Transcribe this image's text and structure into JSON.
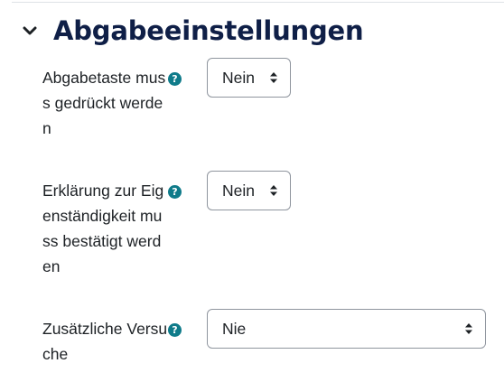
{
  "section": {
    "title": "Abgabeeinstellungen",
    "expanded_icon": "chevron-down-icon"
  },
  "fields": [
    {
      "label": "Abgabetaste muss gedrückt werden",
      "help_icon": "question-circle-icon",
      "help_glyph": "?",
      "value": "Nein"
    },
    {
      "label": "Erklärung zur Eigenständigkeit muss bestätigt werden",
      "help_icon": "question-circle-icon",
      "help_glyph": "?",
      "value": "Nein"
    },
    {
      "label": "Zusätzliche Versuche",
      "help_icon": "question-circle-icon",
      "help_glyph": "?",
      "value": "Nie"
    }
  ],
  "colors": {
    "heading": "#0f1f47",
    "help_icon": "#0f7b8a",
    "select_border": "#8f959e",
    "text": "#1d2125"
  }
}
